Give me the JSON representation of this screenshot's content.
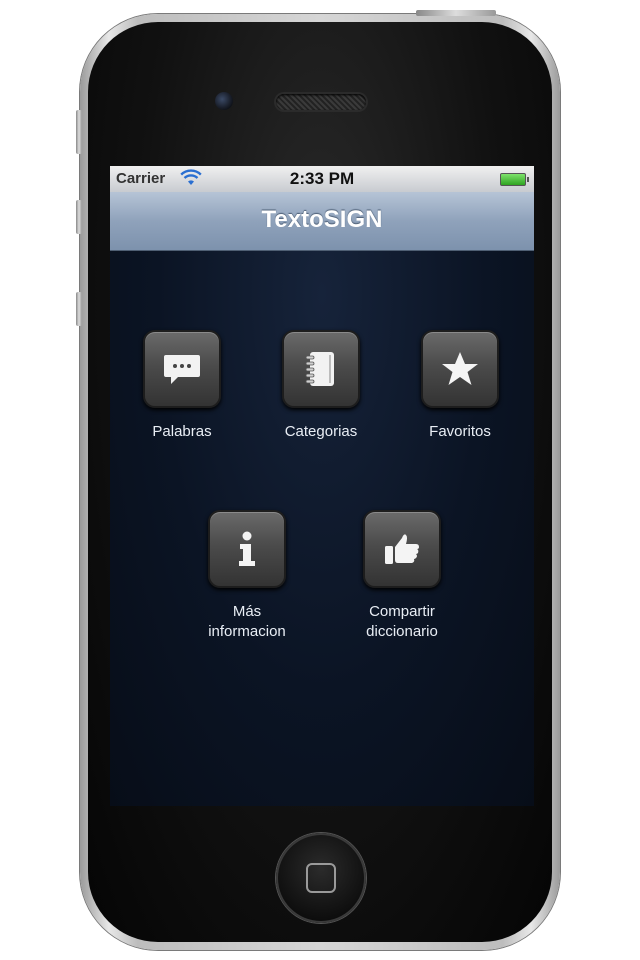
{
  "status_bar": {
    "carrier": "Carrier",
    "time": "2:33 PM"
  },
  "nav": {
    "title": "TextoSIGN"
  },
  "menu": {
    "items": [
      {
        "label": "Palabras",
        "icon": "speech-bubble-icon"
      },
      {
        "label": "Categorias",
        "icon": "notebook-icon"
      },
      {
        "label": "Favoritos",
        "icon": "star-icon"
      },
      {
        "label": "Más\ninformacion",
        "icon": "info-icon"
      },
      {
        "label": "Compartir\ndiccionario",
        "icon": "thumbs-up-icon"
      }
    ]
  },
  "colors": {
    "screen_background": "#0b1424",
    "nav_bar": "#8fa2bb",
    "tile_label": "#e9eef5"
  }
}
